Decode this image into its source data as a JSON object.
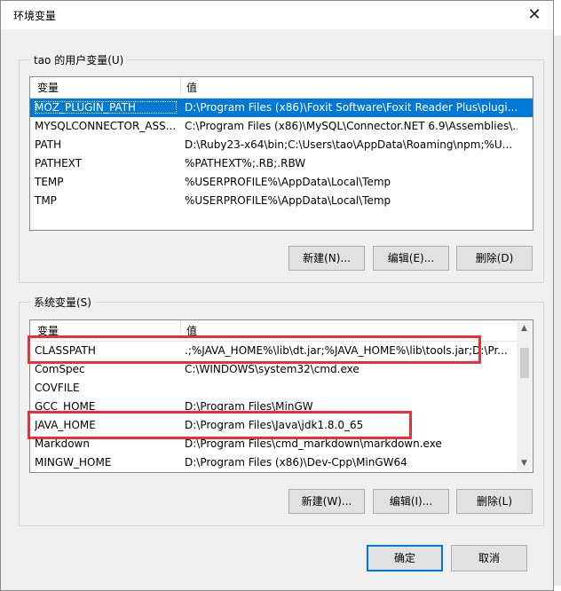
{
  "window": {
    "title": "环境变量",
    "close_glyph": "✕"
  },
  "user_group": {
    "title": "tao 的用户变量(U)",
    "columns": [
      "变量",
      "值"
    ],
    "rows": [
      {
        "name": "MOZ_PLUGIN_PATH",
        "value": "D:\\Program Files (x86)\\Foxit Software\\Foxit Reader Plus\\plugi...",
        "selected": true
      },
      {
        "name": "MYSQLCONNECTOR_ASS...",
        "value": "C:\\Program Files (x86)\\MySQL\\Connector.NET 6.9\\Assemblies\\..."
      },
      {
        "name": "PATH",
        "value": "D:\\Ruby23-x64\\bin;C:\\Users\\tao\\AppData\\Roaming\\npm;%U..."
      },
      {
        "name": "PATHEXT",
        "value": "%PATHEXT%;.RB;.RBW"
      },
      {
        "name": "TEMP",
        "value": "%USERPROFILE%\\AppData\\Local\\Temp"
      },
      {
        "name": "TMP",
        "value": "%USERPROFILE%\\AppData\\Local\\Temp"
      }
    ],
    "buttons": {
      "new": "新建(N)...",
      "edit": "编辑(E)...",
      "delete": "删除(D)"
    }
  },
  "system_group": {
    "title": "系统变量(S)",
    "columns": [
      "变量",
      "值"
    ],
    "rows": [
      {
        "name": "CLASSPATH",
        "value": ".;%JAVA_HOME%\\lib\\dt.jar;%JAVA_HOME%\\lib\\tools.jar;D:\\Pr..."
      },
      {
        "name": "ComSpec",
        "value": "C:\\WINDOWS\\system32\\cmd.exe"
      },
      {
        "name": "COVFILE",
        "value": ""
      },
      {
        "name": "GCC_HOME",
        "value": "D:\\Program Files\\MinGW"
      },
      {
        "name": "JAVA_HOME",
        "value": "D:\\Program Files\\Java\\jdk1.8.0_65"
      },
      {
        "name": "Markdown",
        "value": "D:\\Program Files\\cmd_markdown\\markdown.exe"
      },
      {
        "name": "MINGW_HOME",
        "value": "D:\\Program Files (x86)\\Dev-Cpp\\MinGW64"
      }
    ],
    "buttons": {
      "new": "新建(W)...",
      "edit": "编辑(I)...",
      "delete": "删除(L)"
    },
    "scroll": {
      "position": 0.0
    }
  },
  "footer": {
    "ok": "确定",
    "cancel": "取消"
  },
  "colors": {
    "selection": "#0078d7",
    "highlight_box": "#e8303a",
    "dialog_bg": "#f0f0f0"
  }
}
